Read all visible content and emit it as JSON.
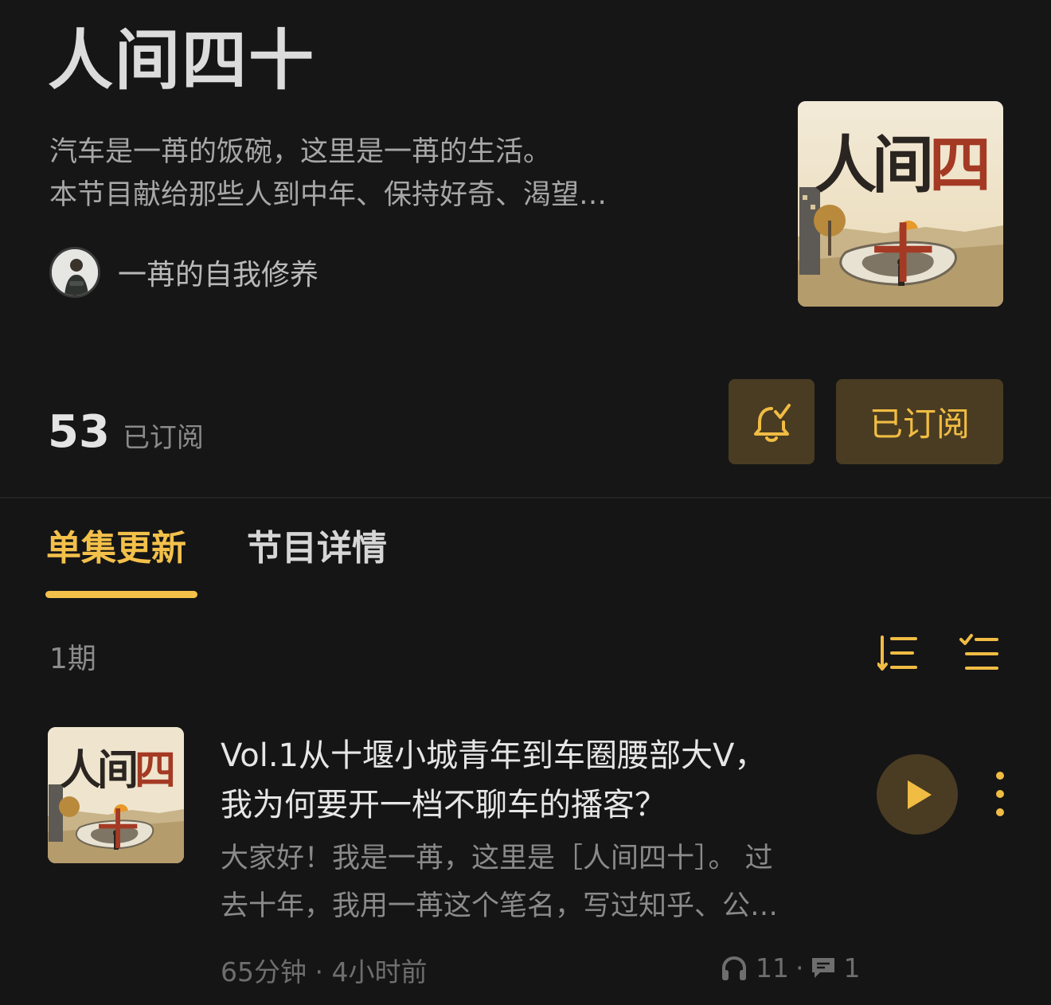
{
  "podcast": {
    "title": "人间四十",
    "description_lines": [
      "汽车是一苒的饭碗，这里是一苒的生活。",
      "本节目献给那些人到中年、保持好奇、渴望…"
    ],
    "author": "一苒的自我修养",
    "cover_title_dark": "人间",
    "cover_title_red": "四十",
    "subscriber_count": "53",
    "subscriber_label": "已订阅",
    "subscribe_button": "已订阅",
    "accent_color": "#f3c04a",
    "button_bg": "#4a3c22"
  },
  "tabs": [
    {
      "label": "单集更新",
      "active": true
    },
    {
      "label": "节目详情",
      "active": false
    }
  ],
  "episode_list": {
    "count_label": "1期",
    "toolbar_icons": [
      "sort-icon",
      "multi-select-icon"
    ]
  },
  "episodes": [
    {
      "title_lines": [
        "Vol.1从十堰小城青年到车圈腰部大V，",
        "我为何要开一档不聊车的播客？"
      ],
      "summary_lines": [
        "大家好！我是一苒，这里是［人间四十］。 过",
        "去十年，我用一苒这个笔名，写过知乎、公…"
      ],
      "duration_time": "65分钟 · 4小时前",
      "plays": "11",
      "separator": "·",
      "comments": "1"
    }
  ]
}
